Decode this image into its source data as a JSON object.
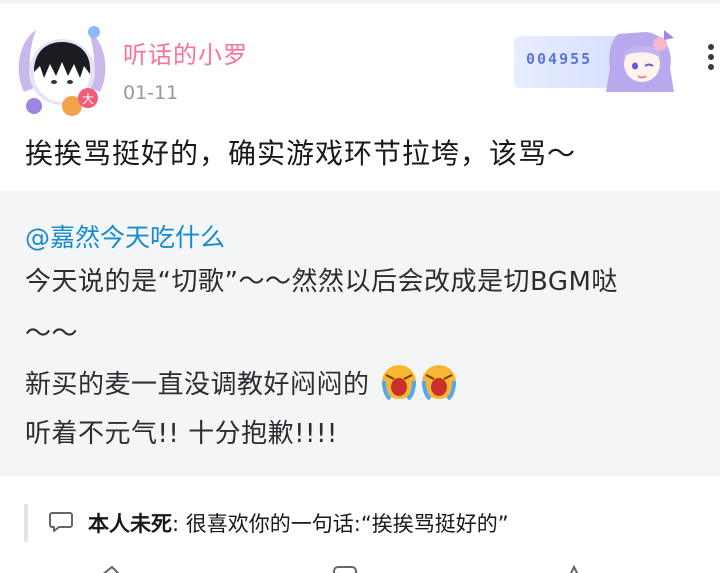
{
  "header": {
    "user_name": "听话的小罗",
    "date": "01-11",
    "fan_badge_number": "004955",
    "level_badge": "大"
  },
  "post": {
    "text": "挨挨骂挺好的，确实游戏环节拉垮，该骂～"
  },
  "quote": {
    "author": "@嘉然今天吃什么",
    "lines": [
      "今天说的是“切歌”～～然然以后会改成是切BGM哒",
      "～～",
      "新买的麦一直没调教好闷闷的",
      "听着不元气!! 十分抱歉!!!!"
    ]
  },
  "comment": {
    "user": "本人未死",
    "text": "很喜欢你的一句话:“挨挨骂挺好的”"
  },
  "icons": {
    "more": "more-vertical-icon",
    "comment": "comment-bubble-icon",
    "emoji": "crying-emoji"
  },
  "colors": {
    "username": "#fb7299",
    "mention": "#178bcf",
    "quote_bg": "#f4f5f7",
    "date": "#9499a0"
  }
}
